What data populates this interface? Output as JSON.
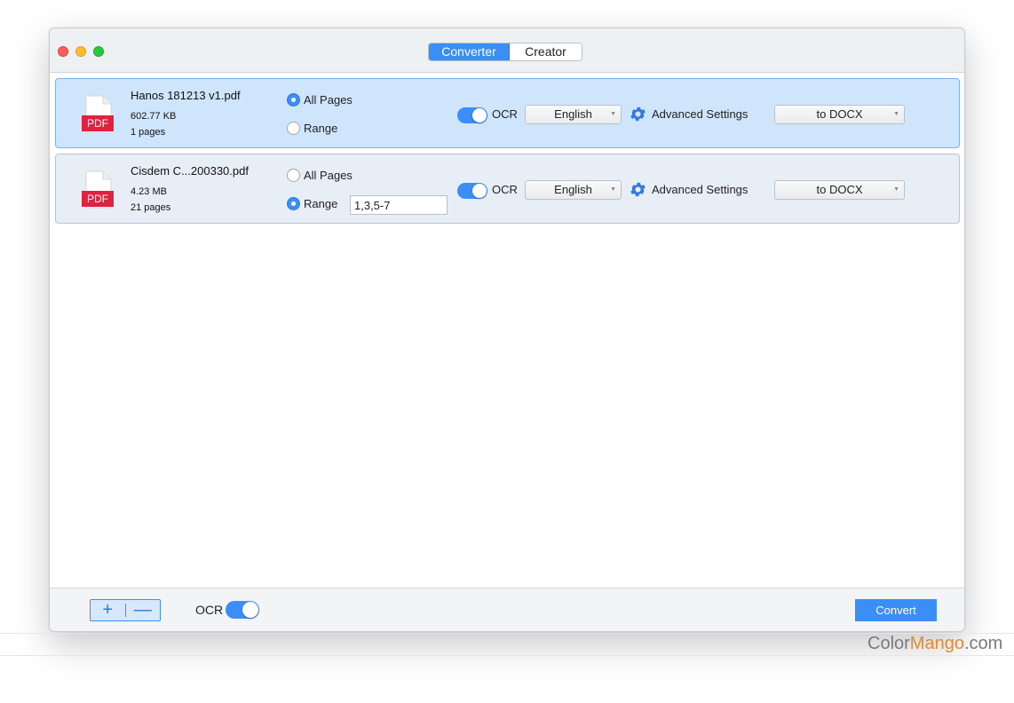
{
  "window": {
    "tabs": [
      {
        "label": "Converter",
        "active": true
      },
      {
        "label": "Creator",
        "active": false
      }
    ]
  },
  "files": [
    {
      "icon_label": "PDF",
      "name": "Hanos 181213 v1.pdf",
      "size": "602.77 KB",
      "pages": "1 pages",
      "all_pages_label": "All Pages",
      "range_label": "Range",
      "page_mode": "all",
      "range_value": "",
      "ocr_label": "OCR",
      "ocr_enabled": true,
      "language": "English",
      "advanced_label": "Advanced Settings",
      "format": "to DOCX",
      "selected": true
    },
    {
      "icon_label": "PDF",
      "name": "Cisdem C...200330.pdf",
      "size": "4.23 MB",
      "pages": "21 pages",
      "all_pages_label": "All Pages",
      "range_label": "Range",
      "page_mode": "range",
      "range_value": "1,3,5-7",
      "ocr_label": "OCR",
      "ocr_enabled": true,
      "language": "English",
      "advanced_label": "Advanced Settings",
      "format": "to DOCX",
      "selected": false
    }
  ],
  "bottom": {
    "add_label": "+",
    "remove_label": "—",
    "ocr_label": "OCR",
    "ocr_enabled": true,
    "convert_label": "Convert"
  },
  "watermark": {
    "part1": "Color",
    "part2": "Mango",
    "part3": ".com"
  },
  "colors": {
    "accent": "#3a8ef6",
    "selected_row": "#cfe5fc",
    "row": "#e8eef6",
    "pdf_badge": "#e0213f"
  },
  "icons": [
    "pdf-file-icon",
    "gear-icon",
    "plus-icon",
    "minus-icon"
  ]
}
